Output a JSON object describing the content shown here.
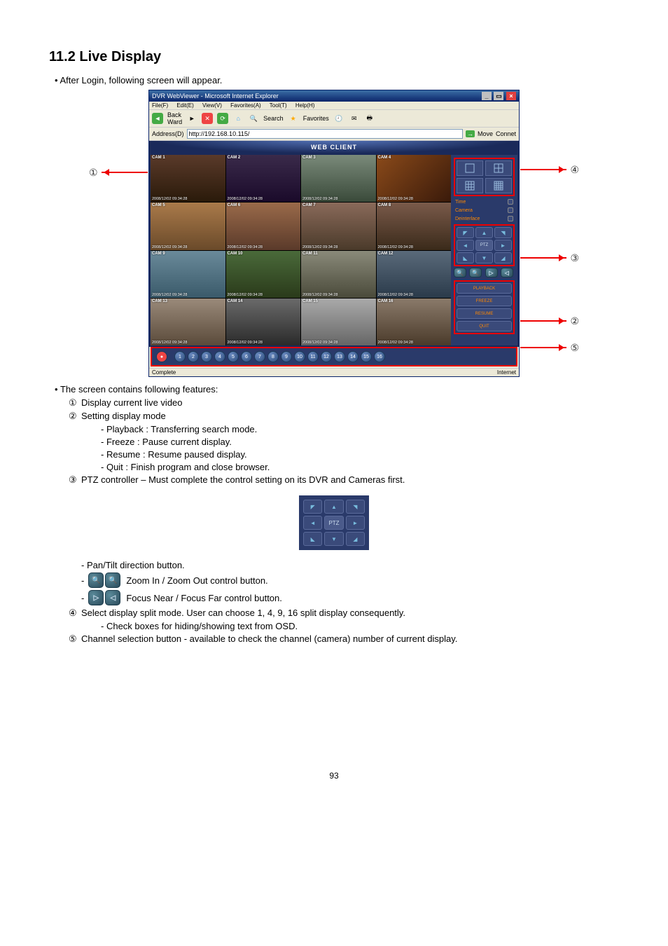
{
  "heading": "11.2   Live Display",
  "intro_bullet": "After Login, following screen will appear.",
  "browser": {
    "title": "DVR WebViewer - Microsoft Internet Explorer",
    "menu": [
      "File(F)",
      "Edit(E)",
      "View(V)",
      "Favorites(A)",
      "Tool(T)",
      "Help(H)"
    ],
    "toolbar": {
      "back": "Back",
      "ward": "Ward",
      "search": "Search",
      "favorites": "Favorites"
    },
    "addr_label": "Address(D)",
    "url": "http://192.168.10.115/",
    "move": "Move",
    "connect": "Connet",
    "webclient": "WEB CLIENT",
    "status_left": "Complete",
    "status_right": "Internet"
  },
  "cams": [
    {
      "label": "CAM 1",
      "ts": "2008/12/02 09:34:28"
    },
    {
      "label": "CAM 2",
      "ts": "2008/12/02 09:34:28"
    },
    {
      "label": "CAM 3",
      "ts": "2008/12/02 09:34:28"
    },
    {
      "label": "CAM 4",
      "ts": "2008/12/02 09:34:28"
    },
    {
      "label": "CAM 5",
      "ts": "2008/12/02 09:34:28"
    },
    {
      "label": "CAM 6",
      "ts": "2008/12/02 09:34:28"
    },
    {
      "label": "CAM 7",
      "ts": "2008/12/02 09:34:28"
    },
    {
      "label": "CAM 8",
      "ts": "2008/12/02 09:34:28"
    },
    {
      "label": "CAM 9",
      "ts": "2008/12/02 09:34:28"
    },
    {
      "label": "CAM 10",
      "ts": "2008/12/02 09:34:28"
    },
    {
      "label": "CAM 11",
      "ts": "2008/12/02 09:34:28"
    },
    {
      "label": "CAM 12",
      "ts": "2008/12/02 09:34:28"
    },
    {
      "label": "CAM 13",
      "ts": "2008/12/02 09:34:28"
    },
    {
      "label": "CAM 14",
      "ts": "2008/12/02 09:34:28"
    },
    {
      "label": "CAM 15",
      "ts": "2008/12/02 09:34:28"
    },
    {
      "label": "CAM 16",
      "ts": "2008/12/02 09:34:28"
    }
  ],
  "side": {
    "osd": {
      "time": "Time",
      "camera": "Camera",
      "deint": "Deinterlace"
    },
    "ptz_center": "PTZ",
    "modes": {
      "playback": "PLAYBACK",
      "freeze": "FREEZE",
      "resume": "RESUME",
      "quit": "QUIT"
    }
  },
  "callouts": {
    "c1": "①",
    "c2": "②",
    "c3": "③",
    "c4": "④",
    "c5": "⑤"
  },
  "features_intro": "The screen contains following features:",
  "features": {
    "f1": "Display current live video",
    "f2": "Setting display mode",
    "f2_sub": [
      "Playback : Transferring search mode.",
      "Freeze : Pause current display.",
      "Resume : Resume paused display.",
      "Quit : Finish program and close browser."
    ],
    "f3": "PTZ controller – Must complete the control setting on its DVR and Cameras first.",
    "f3_sub1": "Pan/Tilt direction button.",
    "f3_sub2": " Zoom In / Zoom Out control button.",
    "f3_sub3": " Focus Near / Focus Far control button.",
    "f4": "Select display split mode. User can choose 1, 4, 9, 16 split display consequently.",
    "f4_sub": "Check boxes for hiding/showing text from OSD.",
    "f5": "Channel selection button - available to check the channel (camera) number of current display."
  },
  "ptz_label": "PTZ",
  "page_number": "93"
}
